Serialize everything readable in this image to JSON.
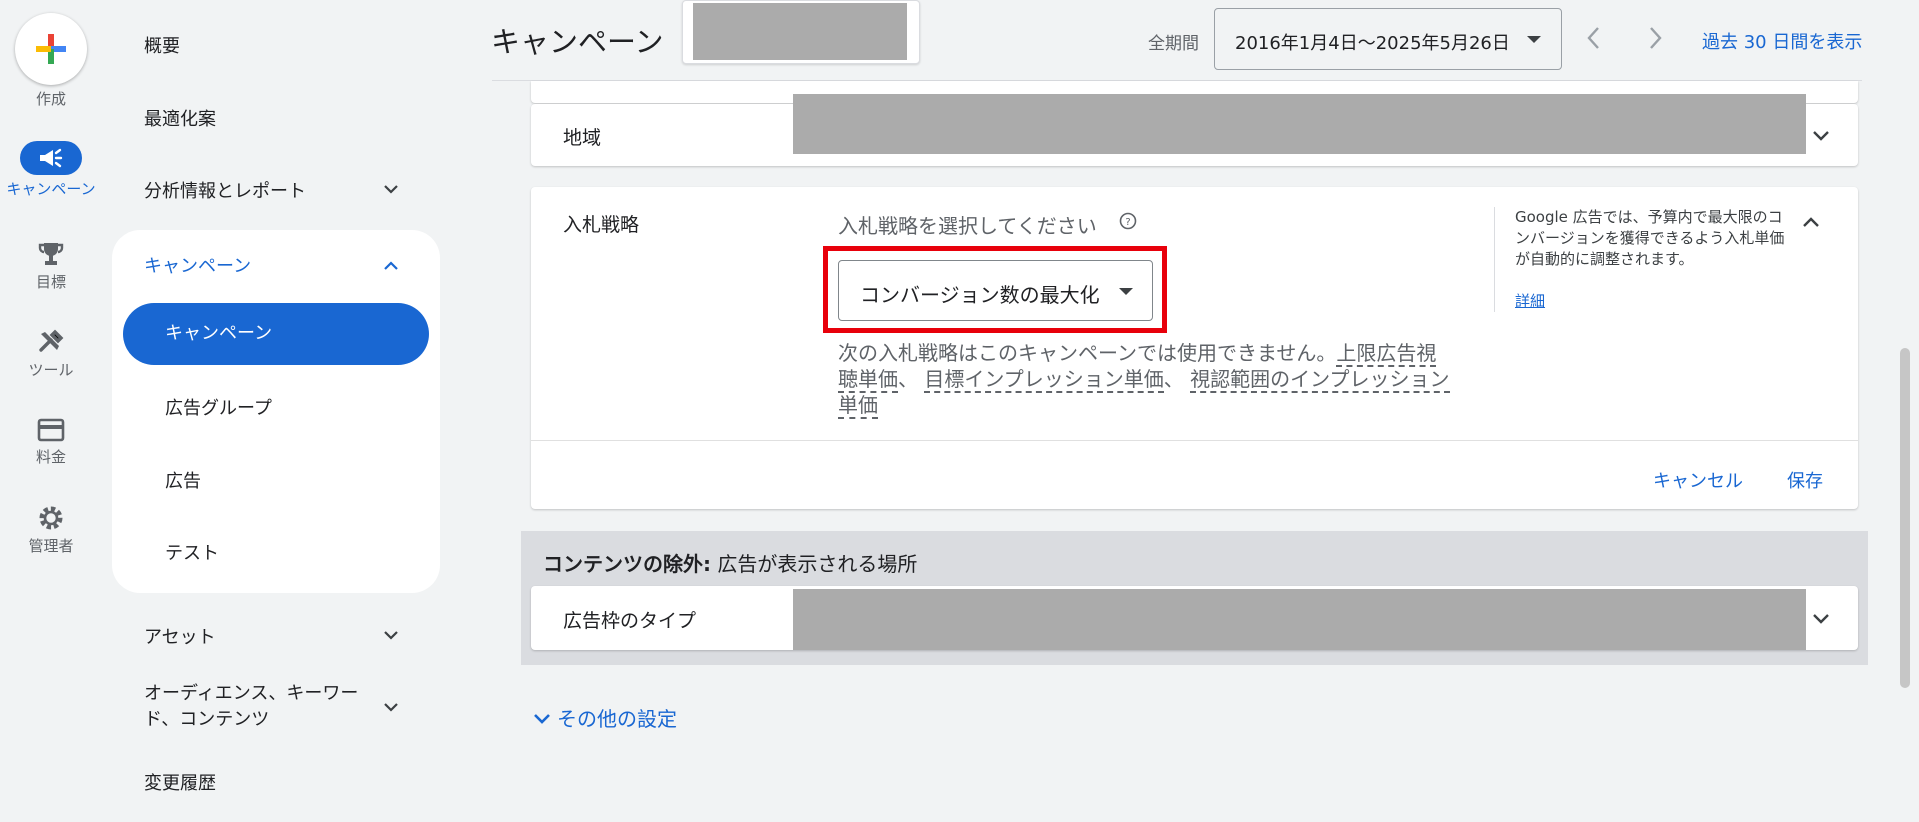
{
  "rail": {
    "create_label": "作成",
    "items": [
      {
        "label": "キャンペーン",
        "icon": "megaphone-icon",
        "active": true
      },
      {
        "label": "目標",
        "icon": "trophy-icon",
        "active": false
      },
      {
        "label": "ツール",
        "icon": "tools-icon",
        "active": false
      },
      {
        "label": "料金",
        "icon": "credit-card-icon",
        "active": false
      },
      {
        "label": "管理者",
        "icon": "gear-icon",
        "active": false
      }
    ]
  },
  "nav": {
    "overview": "概要",
    "recommendations": "最適化案",
    "insights": "分析情報とレポート",
    "campaigns_group": "キャンペーン",
    "campaigns_selected": "キャンペーン",
    "ad_groups": "広告グループ",
    "ads": "広告",
    "test": "テスト",
    "assets": "アセット",
    "audiences": "オーディエンス、キーワー",
    "audiences_line2": "ド、コンテンツ",
    "change_history": "変更履歴"
  },
  "header": {
    "title": "キャンペーン",
    "period_label": "全期間",
    "date_range": "2016年1月4日～2025年5月26日",
    "last30": "過去 30 日間を表示"
  },
  "region": {
    "label": "地域"
  },
  "bidding": {
    "label": "入札戦略",
    "prompt": "入札戦略を選択してください",
    "selected": "コンバージョン数の最大化",
    "unavailable_prefix": "次の入札戦略はこのキャンペーンでは使用できません。",
    "unavailable_line1_link": "上限広告視",
    "unavailable_line2_link_a": "聴単価",
    "sep": "、",
    "link_b": "目標インプレッション単価",
    "link_c": "視認範囲のインプレッション",
    "link_c_2": "単価",
    "side_note": "Google 広告では、予算内で最大限のコンバージョンを獲得できるよう入札単価が自動的に調整されます。",
    "details": "詳細",
    "cancel": "キャンセル",
    "save": "保存"
  },
  "exclusions": {
    "title_bold": "コンテンツの除外:",
    "title_rest": " 広告が表示される場所",
    "inventory_label": "広告枠のタイプ"
  },
  "more_settings": "その他の設定",
  "colors": {
    "accent": "#1967d2",
    "highlight": "#e8000b",
    "redaction": "#ababab"
  }
}
